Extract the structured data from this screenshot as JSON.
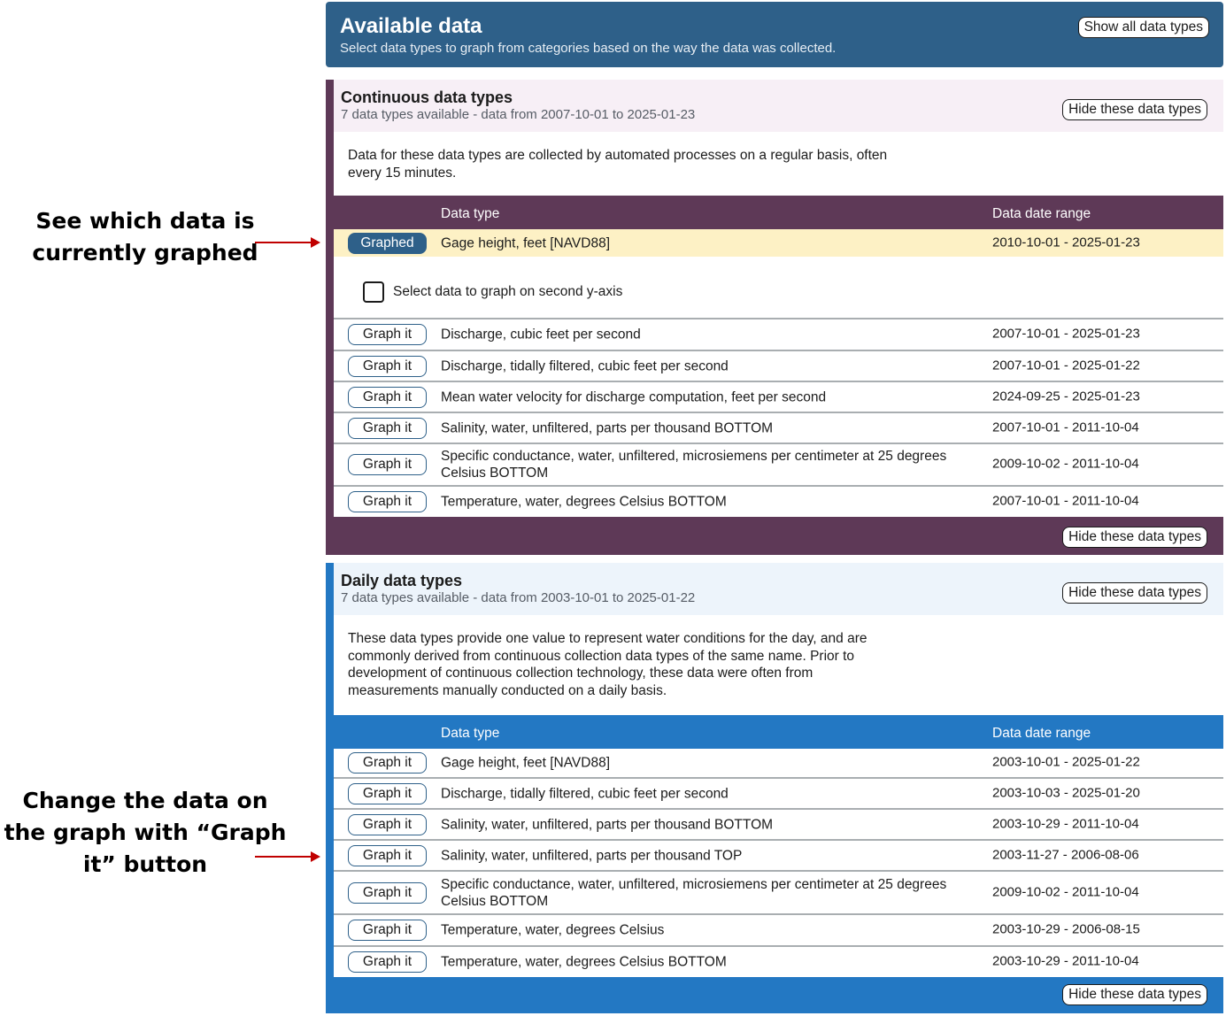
{
  "annotations": {
    "graphed_note": "See which data is currently graphed",
    "graph_it_note": "Change the data on the graph with “Graph it” button"
  },
  "available": {
    "title": "Available data",
    "subtitle": "Select data types to graph from categories based on the way the data was collected.",
    "show_all_label": "Show all data types"
  },
  "continuous": {
    "title": "Continuous data types",
    "meta": "7 data types available - data from 2007-10-01 to 2025-01-23",
    "hide_label": "Hide these data types",
    "description": "Data for these data types are collected by automated processes on a regular basis, often every 15 minutes.",
    "col_type": "Data type",
    "col_range": "Data date range",
    "second_axis_label": "Select data to graph on second y-axis",
    "graphed_label": "Graphed",
    "graph_it_label": "Graph it",
    "rows": [
      {
        "type": "Gage height, feet [NAVD88]",
        "range": "2010-10-01 - 2025-01-23"
      },
      {
        "type": "Discharge, cubic feet per second",
        "range": "2007-10-01 - 2025-01-23"
      },
      {
        "type": "Discharge, tidally filtered, cubic feet per second",
        "range": "2007-10-01 - 2025-01-22"
      },
      {
        "type": "Mean water velocity for discharge computation, feet per second",
        "range": "2024-09-25 - 2025-01-23"
      },
      {
        "type": "Salinity, water, unfiltered, parts per thousand BOTTOM",
        "range": "2007-10-01 - 2011-10-04"
      },
      {
        "type": "Specific conductance, water, unfiltered, microsiemens per centimeter at 25 degrees Celsius BOTTOM",
        "range": "2009-10-02 - 2011-10-04"
      },
      {
        "type": "Temperature, water, degrees Celsius BOTTOM",
        "range": "2007-10-01 - 2011-10-04"
      }
    ]
  },
  "daily": {
    "title": "Daily data types",
    "meta": "7 data types available - data from 2003-10-01 to 2025-01-22",
    "hide_label": "Hide these data types",
    "description": "These data types provide one value to represent water conditions for the day, and are commonly derived from continuous collection data types of the same name. Prior to development of continuous collection technology, these data were often from measurements manually conducted on a daily basis.",
    "col_type": "Data type",
    "col_range": "Data date range",
    "graph_it_label": "Graph it",
    "rows": [
      {
        "type": "Gage height, feet [NAVD88]",
        "range": "2003-10-01 - 2025-01-22"
      },
      {
        "type": "Discharge, tidally filtered, cubic feet per second",
        "range": "2003-10-03 - 2025-01-20"
      },
      {
        "type": "Salinity, water, unfiltered, parts per thousand BOTTOM",
        "range": "2003-10-29 - 2011-10-04"
      },
      {
        "type": "Salinity, water, unfiltered, parts per thousand TOP",
        "range": "2003-11-27 - 2006-08-06"
      },
      {
        "type": "Specific conductance, water, unfiltered, microsiemens per centimeter at 25 degrees Celsius BOTTOM",
        "range": "2009-10-02 - 2011-10-04"
      },
      {
        "type": "Temperature, water, degrees Celsius",
        "range": "2003-10-29 - 2006-08-15"
      },
      {
        "type": "Temperature, water, degrees Celsius BOTTOM",
        "range": "2003-10-29 - 2011-10-04"
      }
    ]
  }
}
